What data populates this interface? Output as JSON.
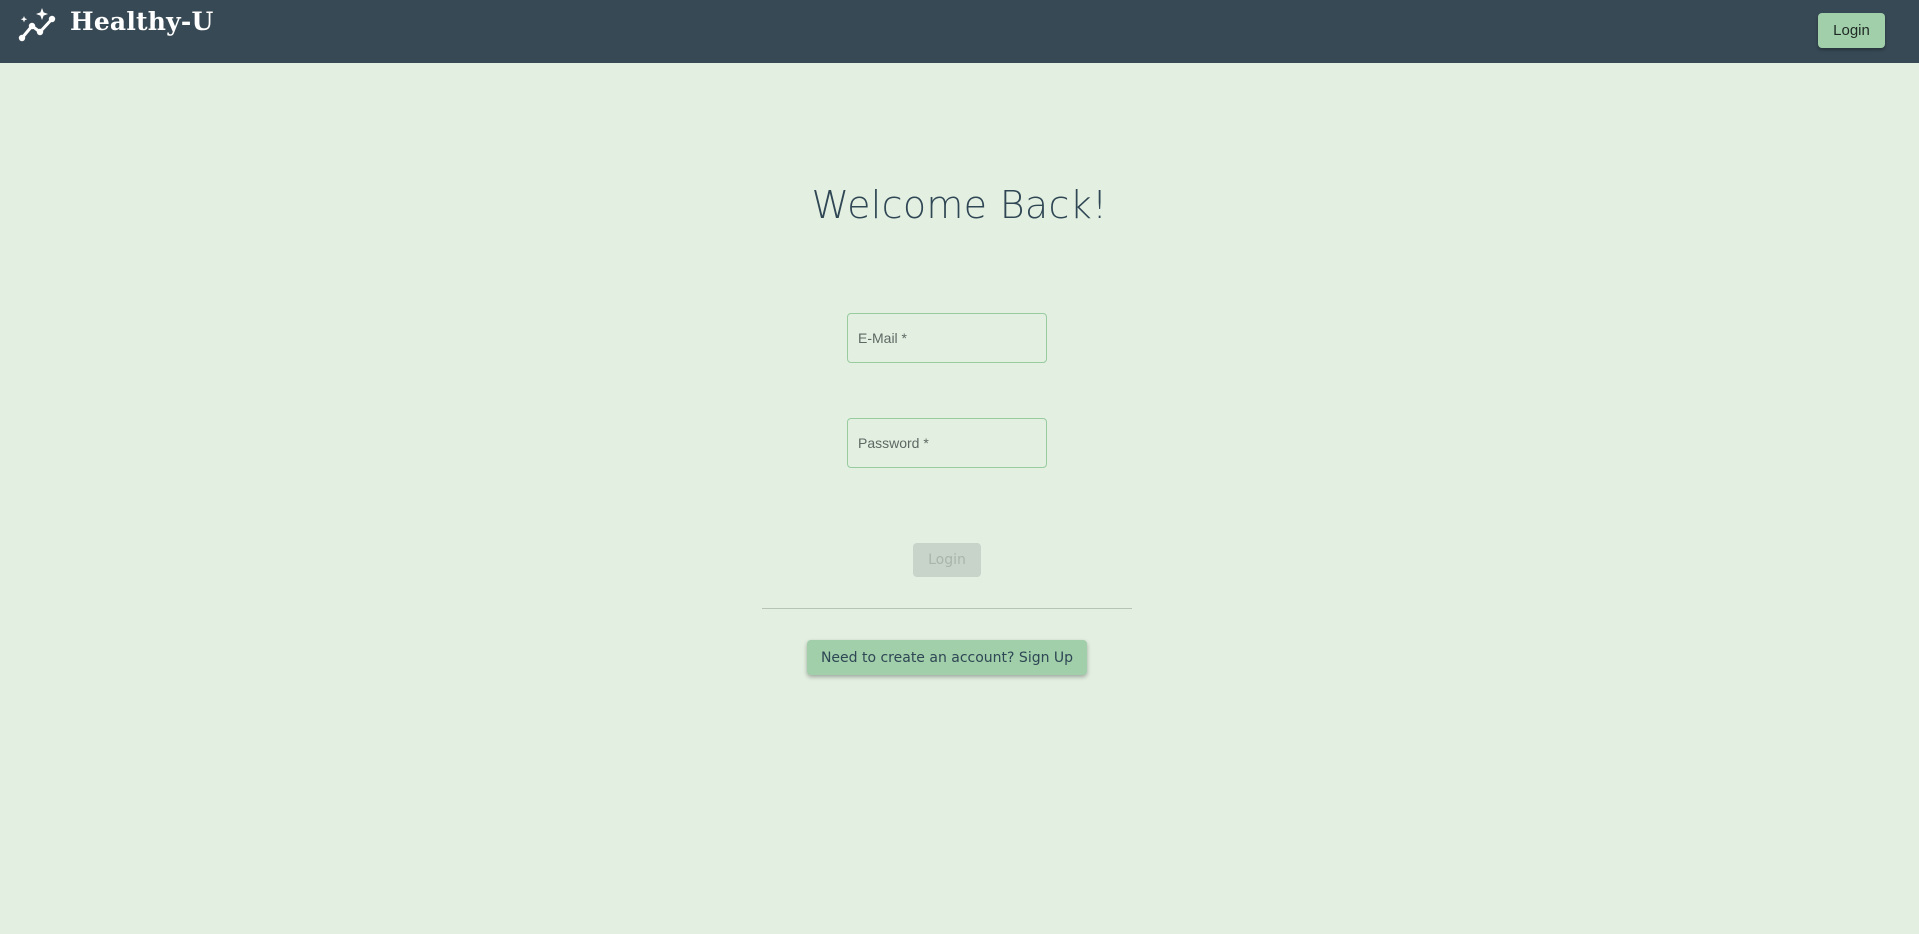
{
  "navbar": {
    "brand": "Healthy-U",
    "login_label": "Login"
  },
  "main": {
    "title": "Welcome Back!",
    "email": {
      "placeholder": "E-Mail *",
      "value": ""
    },
    "password": {
      "placeholder": "Password *",
      "value": ""
    },
    "login_label": "Login",
    "signup_label": "Need to create an account? Sign Up"
  },
  "icons": {
    "brand_icon": "trend-sparkle-icon"
  },
  "colors": {
    "navbar": "#374955",
    "background": "#e3efe1",
    "accent": "#a0cfaa",
    "field_border": "#98cc9f",
    "disabled_button": "#c8d3c9",
    "title_text": "#2f4654"
  }
}
